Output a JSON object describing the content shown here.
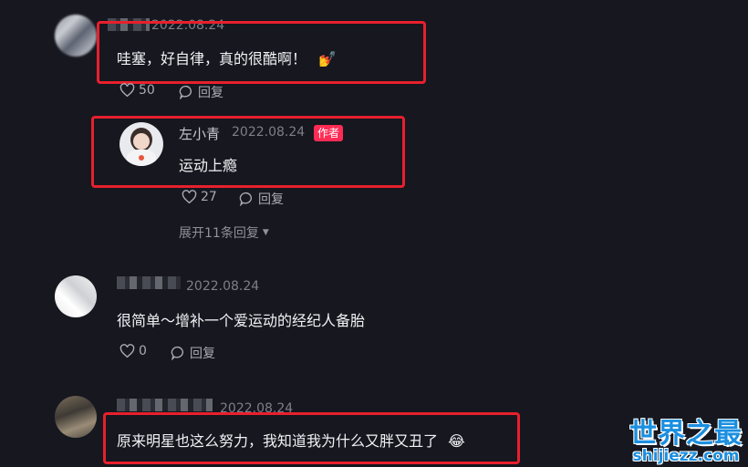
{
  "comments": [
    {
      "date": "2022.08.24",
      "text": "哇塞，好自律，真的很酷啊！",
      "emoji": "💅",
      "likes": "50",
      "reply_label": "回复"
    },
    {
      "author": "左小青",
      "date": "2022.08.24",
      "badge": "作者",
      "text": "运动上瘾",
      "likes": "27",
      "reply_label": "回复",
      "expand_label": "展开11条回复"
    },
    {
      "date": "2022.08.24",
      "text": "很简单～增补一个爱运动的经纪人备胎",
      "likes": "0",
      "reply_label": "回复"
    },
    {
      "date": "2022.08.24",
      "text": "原来明星也这么努力，我知道我为什么又胖又丑了",
      "emoji": "😂"
    }
  ],
  "watermark": {
    "cn": "世界之最",
    "en": "shijiezz.com"
  },
  "colors": {
    "background": "#16171f",
    "highlight_box": "#e8202d",
    "badge": "#fe2c55",
    "watermark": "#1b8fe0"
  }
}
